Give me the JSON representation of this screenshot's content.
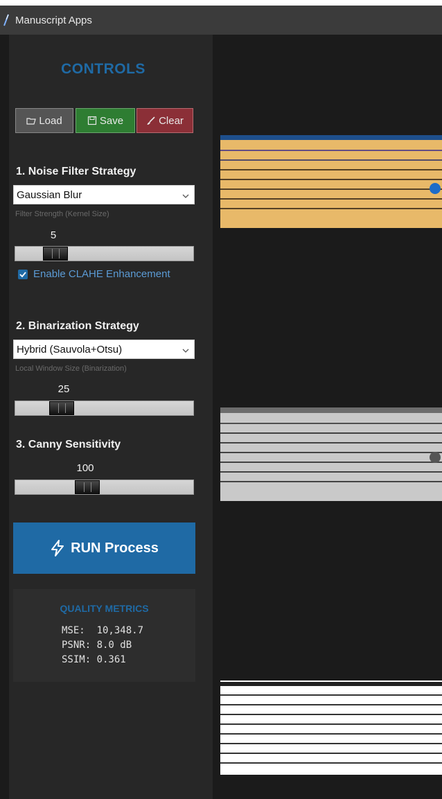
{
  "window": {
    "title": "Manuscript Apps"
  },
  "sidebar": {
    "title": "CONTROLS",
    "buttons": {
      "load": "Load",
      "save": "Save",
      "clear": "Clear"
    },
    "noise": {
      "heading": "1. Noise Filter Strategy",
      "selected": "Gaussian Blur",
      "hint": "Filter Strength (Kernel Size)",
      "value": "5",
      "slider_fraction": 0.18
    },
    "clahe": {
      "label": "Enable CLAHE Enhancement",
      "checked": true
    },
    "binarization": {
      "heading": "2. Binarization Strategy",
      "selected": "Hybrid (Sauvola+Otsu)",
      "hint": "Local Window Size (Binarization)",
      "value": "25",
      "slider_fraction": 0.22
    },
    "canny": {
      "heading": "3. Canny Sensitivity",
      "value": "100",
      "slider_fraction": 0.39
    },
    "run_label": "RUN Process",
    "metrics": {
      "title": "QUALITY METRICS",
      "mse": "MSE:  10,348.7",
      "psnr": "PSNR: 8.0 dB",
      "ssim": "SSIM: 0.361"
    }
  },
  "colors": {
    "accent": "#1f6aa5",
    "save": "#2e7d32",
    "clear": "#8b2f37",
    "load": "#555555",
    "manuscript_original": "#e8b969",
    "manuscript_gray": "#c9c9c9",
    "manuscript_binary": "#ffffff"
  },
  "icons": {
    "title": "feather-icon",
    "load": "folder-icon",
    "save": "floppy-icon",
    "clear": "brush-icon",
    "run": "lightning-icon",
    "select": "chevron-down-icon"
  }
}
